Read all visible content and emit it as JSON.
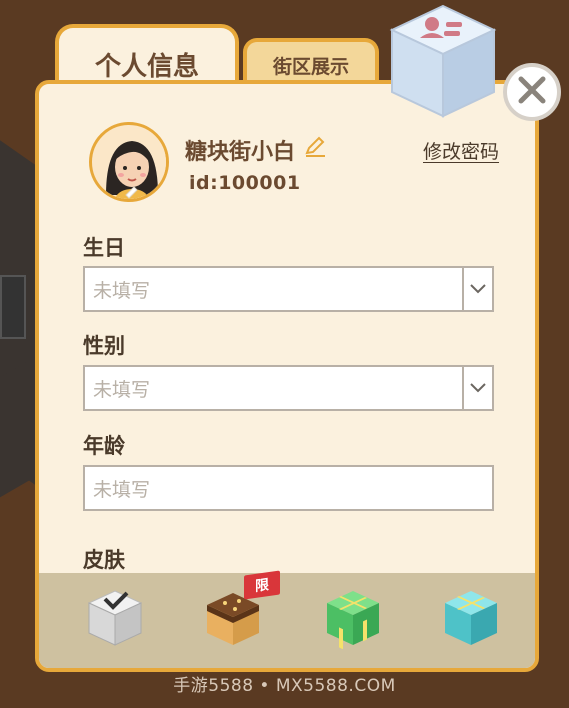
{
  "tabs": {
    "active": "个人信息",
    "inactive": "街区展示"
  },
  "profile": {
    "username": "糖块街小白",
    "id": "id:100001",
    "change_password": "修改密码"
  },
  "fields": [
    {
      "label": "生日",
      "placeholder": "未填写",
      "dropdown": true
    },
    {
      "label": "性别",
      "placeholder": "未填写",
      "dropdown": true
    },
    {
      "label": "年龄",
      "placeholder": "未填写",
      "dropdown": false
    }
  ],
  "skin": {
    "label": "皮肤",
    "limited_badge": "限"
  },
  "watermark": "手游5588 • MX5588.COM",
  "colors": {
    "accent": "#e7a83a",
    "panel": "#fbf1de",
    "text": "#6b4a30"
  }
}
